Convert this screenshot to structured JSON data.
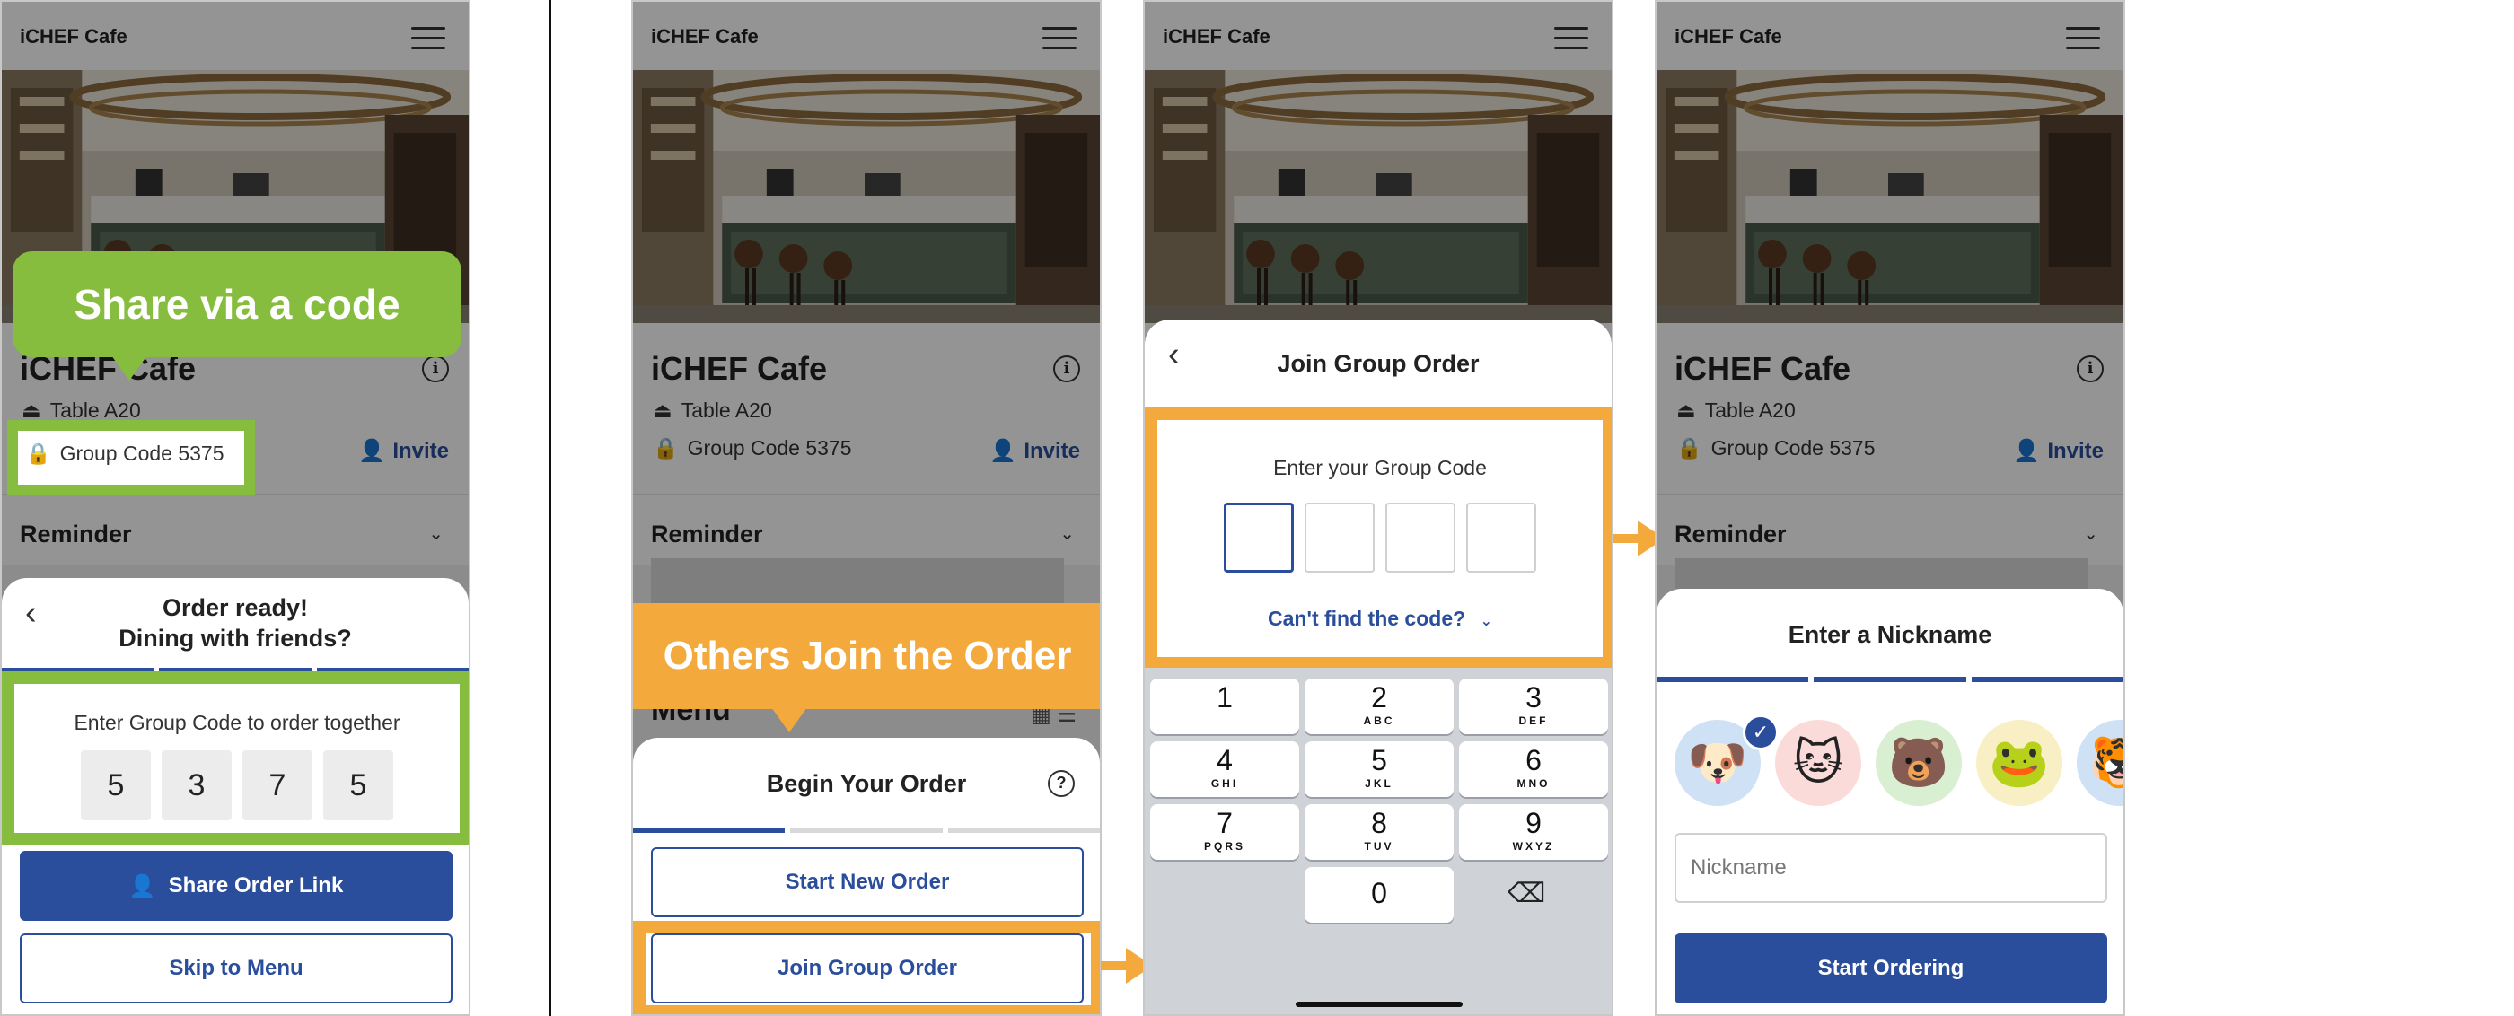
{
  "app": {
    "header_name": "iCHEF Cafe",
    "cafe_title": "iCHEF Cafe",
    "table": "Table A20",
    "group_code": "Group Code 5375",
    "invite": "Invite",
    "reminder": "Reminder",
    "menu": "Menu"
  },
  "screen1": {
    "callout": "Share via a code",
    "sheet_title_line1": "Order ready!",
    "sheet_title_line2": "Dining with friends?",
    "code_prompt": "Enter Group Code to order together",
    "digits": [
      "5",
      "3",
      "7",
      "5"
    ],
    "share_button": "Share Order Link",
    "skip_button": "Skip to Menu"
  },
  "screen2": {
    "callout": "Others Join the Order",
    "sheet_title": "Begin Your Order",
    "start_new_button": "Start New Order",
    "join_button": "Join Group Order"
  },
  "screen3": {
    "sheet_title": "Join Group Order",
    "code_prompt": "Enter your Group Code",
    "cant_find": "Can't find the code?",
    "keys": [
      {
        "n": "1",
        "l": ""
      },
      {
        "n": "2",
        "l": "ABC"
      },
      {
        "n": "3",
        "l": "DEF"
      },
      {
        "n": "4",
        "l": "GHI"
      },
      {
        "n": "5",
        "l": "JKL"
      },
      {
        "n": "6",
        "l": "MNO"
      },
      {
        "n": "7",
        "l": "PQRS"
      },
      {
        "n": "8",
        "l": "TUV"
      },
      {
        "n": "9",
        "l": "WXYZ"
      },
      {
        "n": "0",
        "l": ""
      }
    ]
  },
  "screen4": {
    "sheet_title": "Enter a Nickname",
    "nickname_placeholder": "Nickname",
    "start_button": "Start Ordering",
    "avatars": [
      "🐶",
      "🐱",
      "🐻",
      "🐸",
      "🐯"
    ]
  },
  "colors": {
    "brand_blue": "#2a4e9b",
    "callout_green": "#86bd3e",
    "callout_orange": "#f3a93c"
  }
}
